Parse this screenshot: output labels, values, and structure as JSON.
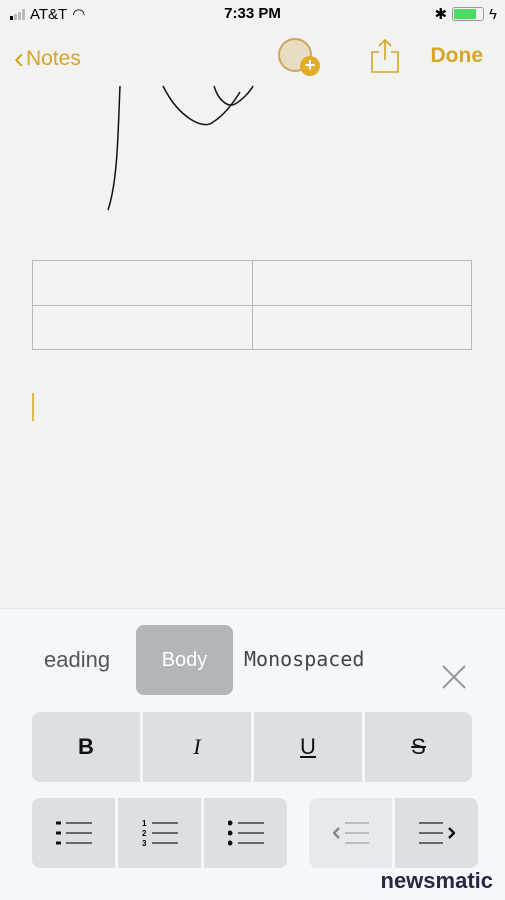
{
  "status": {
    "carrier": "AT&T",
    "time": "7:33 PM",
    "battery_level": 0.8
  },
  "nav": {
    "back_label": "Notes",
    "done_label": "Done"
  },
  "format": {
    "styles": [
      "eading",
      "Body",
      "Monospaced"
    ],
    "selected": "Body",
    "bold": "B",
    "italic": "I",
    "underline": "U",
    "strike": "S"
  },
  "accent": "#d4a52a",
  "watermark": "newsmatic"
}
